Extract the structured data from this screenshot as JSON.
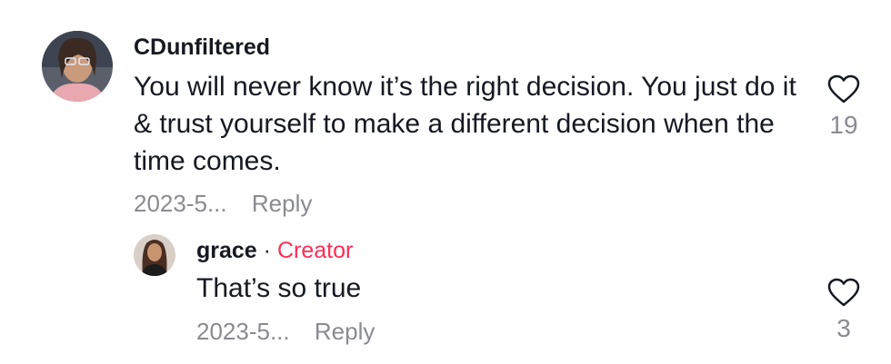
{
  "comments": [
    {
      "username": "CDunfiltered",
      "text": "You will never know it’s the right decision. You just do it & trust yourself to make a different decision when the time comes.",
      "date": "2023-5...",
      "reply_label": "Reply",
      "likes": "19",
      "icon": "heart-outline-icon"
    }
  ],
  "replies": [
    {
      "username": "grace",
      "separator": "·",
      "badge": "Creator",
      "text": "That’s so true",
      "date": "2023-5...",
      "reply_label": "Reply",
      "likes": "3",
      "icon": "heart-outline-icon"
    }
  ],
  "colors": {
    "text": "#161823",
    "secondary": "#8a8b91",
    "creator_badge": "#fe2c55"
  }
}
